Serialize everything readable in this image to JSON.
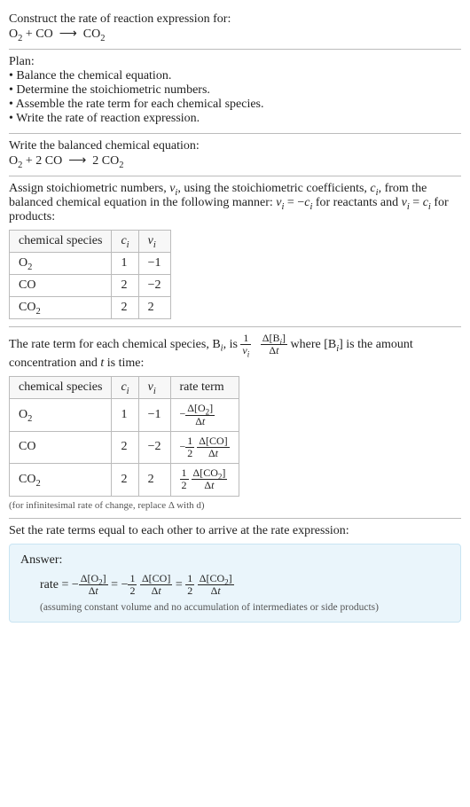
{
  "prompt": {
    "line1": "Construct the rate of reaction expression for:",
    "equation_html": "O<sub>2</sub> + CO &nbsp;⟶&nbsp; CO<sub>2</sub>"
  },
  "plan": {
    "heading": "Plan:",
    "items": [
      "• Balance the chemical equation.",
      "• Determine the stoichiometric numbers.",
      "• Assemble the rate term for each chemical species.",
      "• Write the rate of reaction expression."
    ]
  },
  "balanced": {
    "heading": "Write the balanced chemical equation:",
    "equation_html": "O<sub>2</sub> + 2 CO &nbsp;⟶&nbsp; 2 CO<sub>2</sub>"
  },
  "stoich": {
    "intro_html": "Assign stoichiometric numbers, <span class='italic'>ν<sub>i</sub></span>, using the stoichiometric coefficients, <span class='italic'>c<sub>i</sub></span>, from the balanced chemical equation in the following manner: <span class='italic'>ν<sub>i</sub></span> = −<span class='italic'>c<sub>i</sub></span> for reactants and <span class='italic'>ν<sub>i</sub></span> = <span class='italic'>c<sub>i</sub></span> for products:",
    "headers": [
      "chemical species",
      "c_i",
      "ν_i"
    ],
    "rows": [
      {
        "species_html": "O<sub>2</sub>",
        "c": "1",
        "nu": "−1"
      },
      {
        "species_html": "CO",
        "c": "2",
        "nu": "−2"
      },
      {
        "species_html": "CO<sub>2</sub>",
        "c": "2",
        "nu": "2"
      }
    ]
  },
  "rateterm": {
    "intro_pre": "The rate term for each chemical species, B",
    "intro_mid": ", is ",
    "intro_post_html": " where [B<sub><i>i</i></sub>] is the amount concentration and <span class='italic'>t</span> is time:",
    "headers": [
      "chemical species",
      "c_i",
      "ν_i",
      "rate term"
    ],
    "rows": [
      {
        "species_html": "O<sub>2</sub>",
        "c": "1",
        "nu": "−1",
        "rate_html": "−<span class='frac'><span class='num'>Δ[O<sub>2</sub>]</span><span class='den'>Δ<i>t</i></span></span>"
      },
      {
        "species_html": "CO",
        "c": "2",
        "nu": "−2",
        "rate_html": "−<span class='frac'><span class='num'>1</span><span class='den'>2</span></span>&nbsp;<span class='frac'><span class='num'>Δ[CO]</span><span class='den'>Δ<i>t</i></span></span>"
      },
      {
        "species_html": "CO<sub>2</sub>",
        "c": "2",
        "nu": "2",
        "rate_html": "<span class='frac'><span class='num'>1</span><span class='den'>2</span></span>&nbsp;<span class='frac'><span class='num'>Δ[CO<sub>2</sub>]</span><span class='den'>Δ<i>t</i></span></span>"
      }
    ],
    "note": "(for infinitesimal rate of change, replace Δ with d)"
  },
  "final": {
    "heading": "Set the rate terms equal to each other to arrive at the rate expression:",
    "answer_label": "Answer:",
    "rate_html": "rate = −<span class='frac'><span class='num'>Δ[O<sub>2</sub>]</span><span class='den'>Δ<i>t</i></span></span> = −<span class='frac'><span class='num'>1</span><span class='den'>2</span></span>&nbsp;<span class='frac'><span class='num'>Δ[CO]</span><span class='den'>Δ<i>t</i></span></span> = <span class='frac'><span class='num'>1</span><span class='den'>2</span></span>&nbsp;<span class='frac'><span class='num'>Δ[CO<sub>2</sub>]</span><span class='den'>Δ<i>t</i></span></span>",
    "assumption": "(assuming constant volume and no accumulation of intermediates or side products)"
  }
}
